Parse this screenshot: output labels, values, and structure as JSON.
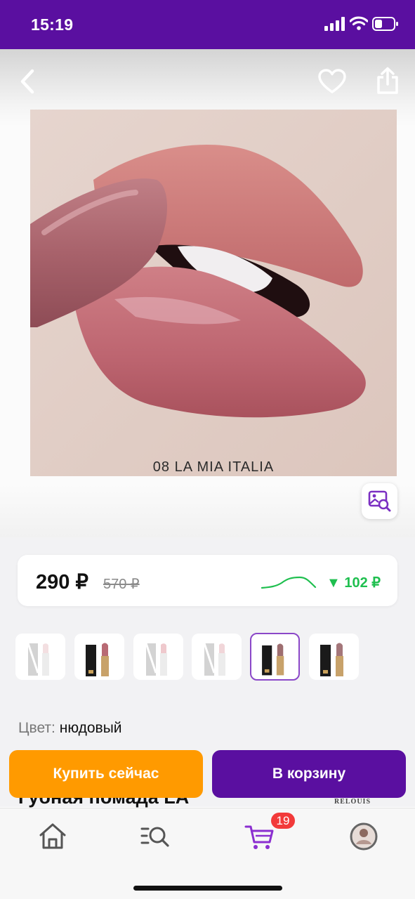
{
  "status_bar": {
    "time": "15:19"
  },
  "product": {
    "photo_caption": "08 LA MIA ITALIA",
    "price_current": "290 ₽",
    "price_old": "570 ₽",
    "price_drop": "▼ 102 ₽",
    "color_label": "Цвет:",
    "color_value": "нюдовый",
    "title_partial": "Губная помада LA",
    "brand_logo": "RELOUIS",
    "variants": [
      {
        "state": "unavailable",
        "selected": false
      },
      {
        "state": "available",
        "selected": false
      },
      {
        "state": "unavailable",
        "selected": false
      },
      {
        "state": "unavailable",
        "selected": false
      },
      {
        "state": "available",
        "selected": true
      },
      {
        "state": "available",
        "selected": false
      }
    ]
  },
  "actions": {
    "buy_now": "Купить сейчас",
    "add_to_cart": "В корзину"
  },
  "tabbar": {
    "items": [
      "home-icon",
      "catalog-search-icon",
      "cart-icon",
      "profile-avatar"
    ],
    "cart_count": "19"
  },
  "colors": {
    "brand_purple": "#5a0fa0",
    "accent_orange": "#ff9a00",
    "price_drop_green": "#1fbf4f",
    "badge_red": "#f23a3a"
  }
}
